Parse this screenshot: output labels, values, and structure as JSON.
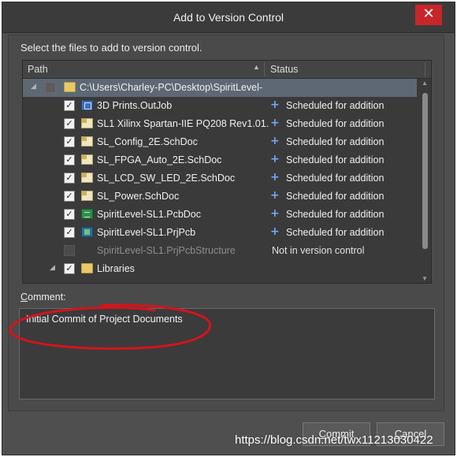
{
  "dialog": {
    "title": "Add to Version Control",
    "close_glyph": "✕",
    "instruction": "Select the files to add to version control."
  },
  "grid": {
    "headers": {
      "path": "Path",
      "status": "Status",
      "sort_indicator": "▲"
    },
    "rows": [
      {
        "name": "C:\\Users\\Charley-PC\\Desktop\\SpiritLevel-",
        "status": "",
        "checked": false,
        "icon": "folder-icon"
      },
      {
        "name": "3D Prints.OutJob",
        "status": "Scheduled for addition",
        "checked": true,
        "icon": "outjob-icon"
      },
      {
        "name": "SL1 Xilinx Spartan-IIE PQ208 Rev1.01.",
        "status": "Scheduled for addition",
        "checked": true,
        "icon": "schdoc-icon"
      },
      {
        "name": "SL_Config_2E.SchDoc",
        "status": "Scheduled for addition",
        "checked": true,
        "icon": "schdoc-icon"
      },
      {
        "name": "SL_FPGA_Auto_2E.SchDoc",
        "status": "Scheduled for addition",
        "checked": true,
        "icon": "schdoc-icon"
      },
      {
        "name": "SL_LCD_SW_LED_2E.SchDoc",
        "status": "Scheduled for addition",
        "checked": true,
        "icon": "schdoc-icon"
      },
      {
        "name": "SL_Power.SchDoc",
        "status": "Scheduled for addition",
        "checked": true,
        "icon": "schdoc-icon"
      },
      {
        "name": "SpiritLevel-SL1.PcbDoc",
        "status": "Scheduled for addition",
        "checked": true,
        "icon": "pcbdoc-icon"
      },
      {
        "name": "SpiritLevel-SL1.PrjPcb",
        "status": "Scheduled for addition",
        "checked": true,
        "icon": "prjpcb-icon"
      },
      {
        "name": "SpiritLevel-SL1.PrjPcbStructure",
        "status": "Not in version control",
        "checked": false,
        "icon": "structure-icon"
      },
      {
        "name": "Libraries",
        "status": "",
        "checked": true,
        "icon": "folder-icon"
      }
    ],
    "plus_glyph": "+",
    "check_glyph": "✓"
  },
  "comment": {
    "label_accel": "C",
    "label_rest": "omment:",
    "value": "Initial Commit of Project Documents"
  },
  "buttons": {
    "commit_accel": "C",
    "commit_rest": "ommit",
    "cancel_accel": "C",
    "cancel_rest": "ancel"
  },
  "watermark": "https://blog.csdn.net/twx11213030422",
  "colors": {
    "dialog_bg": "#4f4f4f",
    "selection": "#5d6874",
    "close_button": "#c8262a",
    "plus": "#6fa8ff",
    "annotation": "#d4141b"
  }
}
